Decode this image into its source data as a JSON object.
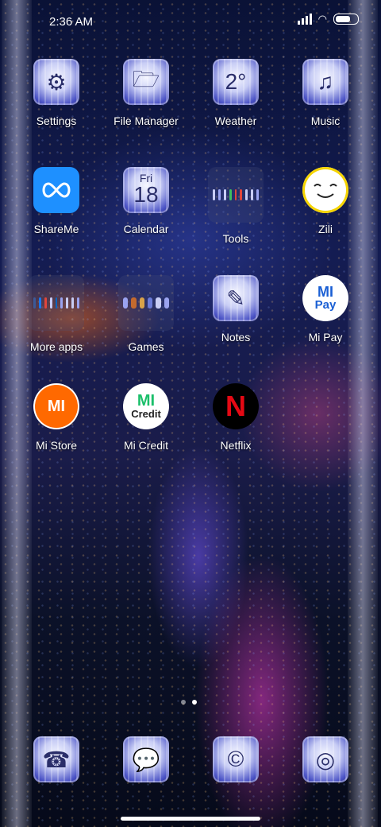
{
  "status_bar": {
    "time": "2:36 AM"
  },
  "apps": [
    {
      "label": "Settings",
      "icon": "settings-icon"
    },
    {
      "label": "File Manager",
      "icon": "file-manager-icon"
    },
    {
      "label": "Weather",
      "icon": "weather-icon",
      "glyph": "2°"
    },
    {
      "label": "Music",
      "icon": "music-icon"
    },
    {
      "label": "ShareMe",
      "icon": "shareme-icon"
    },
    {
      "label": "Calendar",
      "icon": "calendar-icon",
      "day": "Fri",
      "date": "18"
    },
    {
      "label": "Tools",
      "icon": "tools-folder-icon"
    },
    {
      "label": "Zili",
      "icon": "zili-icon"
    },
    {
      "label": "More apps",
      "icon": "more-apps-folder-icon"
    },
    {
      "label": "Games",
      "icon": "games-folder-icon"
    },
    {
      "label": "Notes",
      "icon": "notes-icon"
    },
    {
      "label": "Mi Pay",
      "icon": "mi-pay-icon",
      "glyph_top": "MI",
      "glyph_bottom": "Pay"
    },
    {
      "label": "Mi Store",
      "icon": "mi-store-icon",
      "glyph": "MI"
    },
    {
      "label": "Mi Credit",
      "icon": "mi-credit-icon",
      "glyph_top": "MI",
      "glyph_bottom": "Credit"
    },
    {
      "label": "Netflix",
      "icon": "netflix-icon",
      "glyph": "N"
    }
  ],
  "dock": [
    {
      "icon": "phone-icon"
    },
    {
      "icon": "messages-icon"
    },
    {
      "icon": "browser-icon",
      "glyph": "©"
    },
    {
      "icon": "camera-icon"
    }
  ],
  "colors": {
    "netflix_red": "#e50914",
    "mi_orange": "#ff6900",
    "mi_credit_green": "#1bbf6a",
    "mi_pay_blue": "#1a5fd4",
    "shareme_blue": "#1e90ff"
  }
}
